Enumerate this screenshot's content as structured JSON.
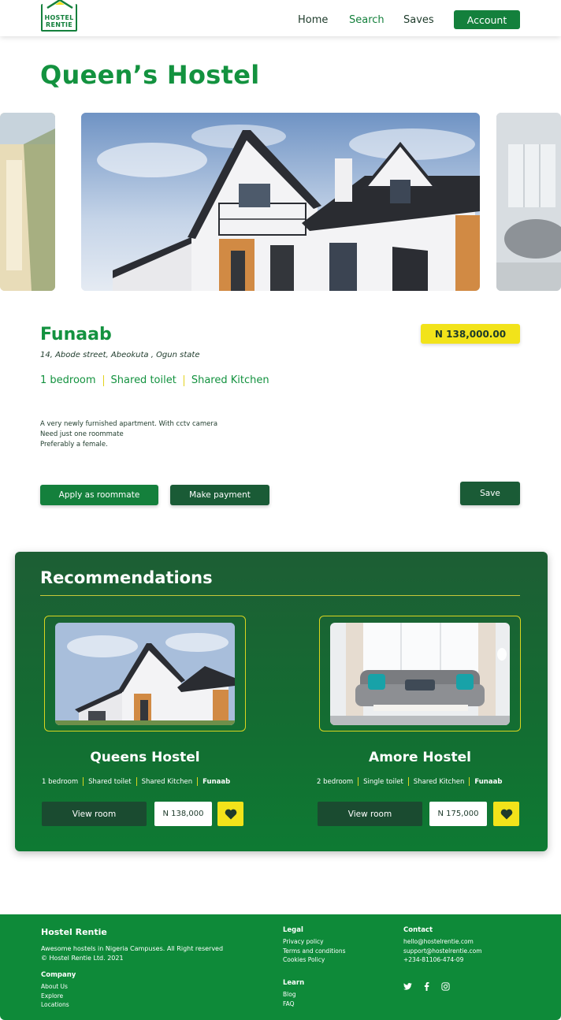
{
  "nav": {
    "logo_line1": "HOSTEL",
    "logo_line2": "RENTIE",
    "links": [
      "Home",
      "Search",
      "Saves"
    ],
    "active": "Search",
    "account_label": "Account"
  },
  "hostel": {
    "title": "Queen’s Hostel",
    "campus": "Funaab",
    "address": "14, Abode street, Abeokuta , Ogun state",
    "price": "N 138,000.00",
    "features": [
      "1 bedroom",
      "Shared toilet",
      "Shared Kitchen"
    ],
    "description": [
      "A very newly furnished apartment. With cctv camera",
      "Need just one roommate",
      "Preferably a female."
    ],
    "apply_label": "Apply as roommate",
    "payment_label": "Make payment",
    "save_label": "Save"
  },
  "recommendations": {
    "title": "Recommendations",
    "cards": [
      {
        "name": "Queens Hostel",
        "features": [
          "1 bedroom",
          "Shared toilet",
          "Shared Kitchen"
        ],
        "campus": "Funaab",
        "view_label": "View room",
        "price": "N 138,000"
      },
      {
        "name": "Amore  Hostel",
        "features": [
          "2 bedroom",
          "Single toilet",
          "Shared Kitchen"
        ],
        "campus": "Funaab",
        "view_label": "View room",
        "price": "N 175,000"
      }
    ]
  },
  "footer": {
    "brand": "Hostel Rentie",
    "tagline": "Awesome hostels in Nigeria Campuses. All Right reserved",
    "copyright": "© Hostel Rentie Ltd. 2021",
    "company": {
      "heading": "Company",
      "links": [
        "About Us",
        "Explore",
        "Locations"
      ]
    },
    "legal": {
      "heading": "Legal",
      "links": [
        "Privacy policy",
        "Terms and conditions",
        "Cookies Policy"
      ]
    },
    "learn": {
      "heading": "Learn",
      "links": [
        "Blog",
        "FAQ"
      ]
    },
    "contact": {
      "heading": "Contact",
      "lines": [
        "hello@hostelrentie.com",
        "support@hostelrentie.com",
        "+234-81106-474-09"
      ]
    },
    "social_icons": [
      "twitter-icon",
      "facebook-icon",
      "instagram-icon"
    ]
  },
  "colors": {
    "brand_green": "#14803c",
    "accent_yellow": "#f2e31a",
    "dark_green": "#1a5b36"
  }
}
